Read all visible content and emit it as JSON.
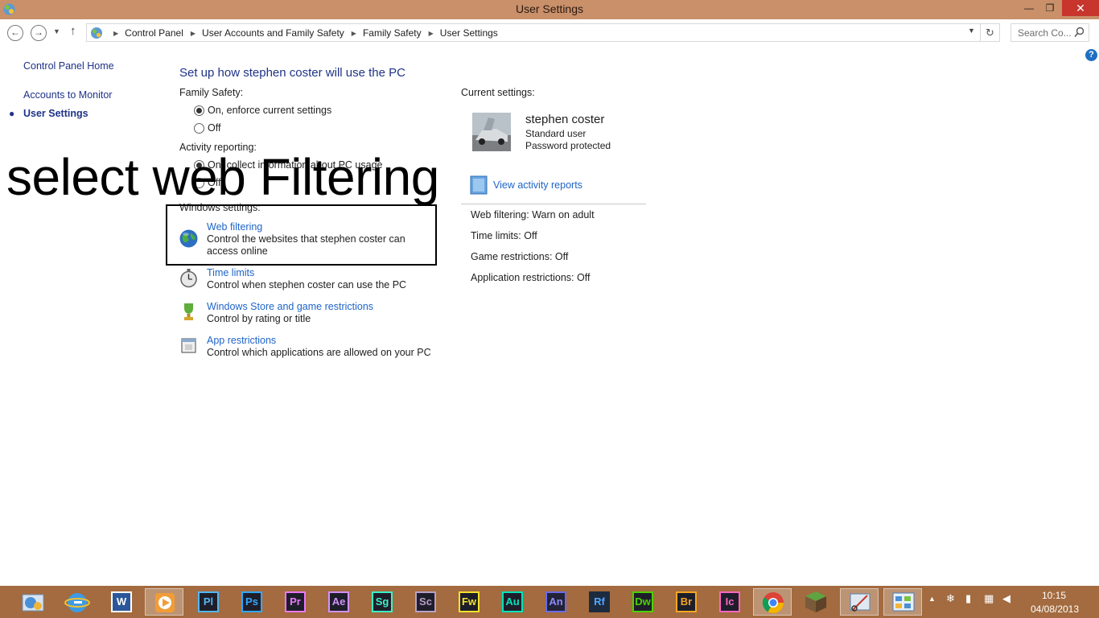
{
  "window": {
    "title": "User Settings",
    "minimize_glyph": "—",
    "maximize_glyph": "❐",
    "close_glyph": "✕"
  },
  "address": {
    "breadcrumbs": [
      "Control Panel",
      "User Accounts and Family Safety",
      "Family Safety",
      "User Settings"
    ],
    "search_placeholder": "Search Co..."
  },
  "left_pane": {
    "home": "Control Panel Home",
    "accounts": "Accounts to Monitor",
    "user_settings": "User Settings"
  },
  "main": {
    "title": "Set up how stephen coster will use the PC",
    "family_safety": {
      "label": "Family Safety:",
      "options": [
        "On, enforce current settings",
        "Off"
      ],
      "selected": 0
    },
    "activity_reporting": {
      "label": "Activity reporting:",
      "options": [
        "On, collect information about PC usage",
        "Off"
      ],
      "selected": 0
    },
    "windows_settings_label": "Windows settings:",
    "settings": [
      {
        "title": "Web filtering",
        "description": "Control the websites that stephen coster can access online",
        "icon": "globe-icon"
      },
      {
        "title": "Time limits",
        "description": "Control when stephen coster can use the PC",
        "icon": "stopwatch-icon"
      },
      {
        "title": "Windows Store and game restrictions",
        "description": "Control by rating or title",
        "icon": "trophy-icon"
      },
      {
        "title": "App restrictions",
        "description": "Control which applications are allowed on your PC",
        "icon": "app-window-icon"
      }
    ]
  },
  "current_settings": {
    "label": "Current settings:",
    "user_name": "stephen coster",
    "user_type": "Standard user",
    "password_status": "Password protected",
    "activity_link": "View activity reports",
    "summary": [
      {
        "key": "Web filtering:",
        "value": "Warn on adult"
      },
      {
        "key": "Time limits:",
        "value": "Off"
      },
      {
        "key": "Game restrictions:",
        "value": "Off"
      },
      {
        "key": "Application restrictions:",
        "value": "Off"
      }
    ]
  },
  "overlay_caption": "select web Filtering",
  "taskbar": {
    "apps": [
      {
        "name": "control-panel",
        "icon": "control-panel-icon"
      },
      {
        "name": "internet-explorer",
        "icon": "ie-icon"
      },
      {
        "name": "word",
        "label": "W",
        "color": "#2b579a"
      },
      {
        "name": "media-player",
        "icon": "media-player-icon"
      },
      {
        "name": "prelude",
        "label": "Pl",
        "color": "#52b7f5"
      },
      {
        "name": "photoshop",
        "label": "Ps",
        "color": "#31a8ff"
      },
      {
        "name": "premiere",
        "label": "Pr",
        "color": "#ea77ff"
      },
      {
        "name": "after-effects",
        "label": "Ae",
        "color": "#d291ff"
      },
      {
        "name": "speedgrade",
        "label": "Sg",
        "color": "#3df0c8"
      },
      {
        "name": "scout",
        "label": "Sc",
        "color": "#b7a0c8"
      },
      {
        "name": "fireworks",
        "label": "Fw",
        "color": "#f3e22d"
      },
      {
        "name": "audition",
        "label": "Au",
        "color": "#00e4bb"
      },
      {
        "name": "animate",
        "label": "An",
        "color": "#6b6be8"
      },
      {
        "name": "reflow",
        "label": "Rf",
        "color": "#52a7ff"
      },
      {
        "name": "dreamweaver",
        "label": "Dw",
        "color": "#4bd200"
      },
      {
        "name": "bridge",
        "label": "Br",
        "color": "#f5a623"
      },
      {
        "name": "incopy",
        "label": "Ic",
        "color": "#ff66c4"
      },
      {
        "name": "chrome",
        "icon": "chrome-icon"
      },
      {
        "name": "minecraft",
        "icon": "grass-block-icon"
      },
      {
        "name": "snipping-tool",
        "icon": "snipping-tool-icon"
      },
      {
        "name": "control-panel-active",
        "icon": "control-panel-window-icon"
      }
    ],
    "clock_time": "10:15",
    "clock_date": "04/08/2013"
  }
}
